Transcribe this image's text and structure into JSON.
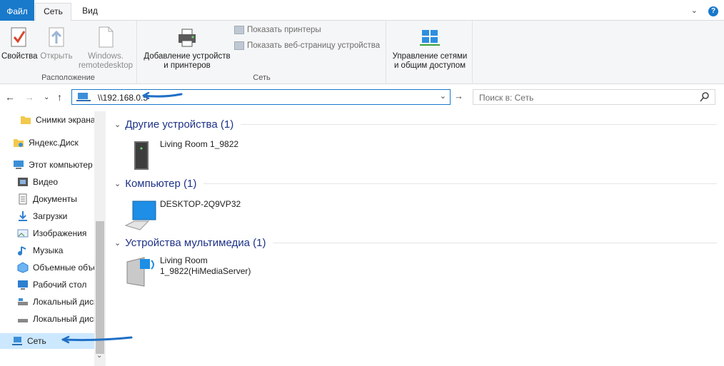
{
  "ribbon": {
    "tabs": {
      "file": "Файл",
      "network": "Сеть",
      "view": "Вид"
    },
    "groups": {
      "location": {
        "label": "Расположение",
        "properties": "Свойства",
        "open": "Открыть",
        "windows_remote_1": "Windows.",
        "windows_remote_2": "remotedesktop"
      },
      "network": {
        "label": "Сеть",
        "add_devices_1": "Добавление устройств",
        "add_devices_2": "и принтеров",
        "show_printers": "Показать принтеры",
        "show_device_page": "Показать веб-страницу устройства"
      },
      "manage": {
        "manage_1": "Управление сетями",
        "manage_2": "и общим доступом"
      }
    }
  },
  "address": {
    "path": "\\\\192.168.0.5",
    "search_placeholder": "Поиск в: Сеть"
  },
  "sidebar": {
    "items": [
      {
        "label": "Снимки экрана"
      },
      {
        "label": "Яндекс.Диск"
      },
      {
        "label": "Этот компьютер"
      },
      {
        "label": "Видео"
      },
      {
        "label": "Документы"
      },
      {
        "label": "Загрузки"
      },
      {
        "label": "Изображения"
      },
      {
        "label": "Музыка"
      },
      {
        "label": "Объемные объекты"
      },
      {
        "label": "Рабочий стол"
      },
      {
        "label": "Локальный диск (C:)"
      },
      {
        "label": "Локальный диск (D:)"
      },
      {
        "label": "Сеть"
      }
    ]
  },
  "content": {
    "groups": [
      {
        "title": "Другие устройства (1)",
        "device": "Living Room 1_9822"
      },
      {
        "title": "Компьютер (1)",
        "device": "DESKTOP-2Q9VP32"
      },
      {
        "title": "Устройства мультимедиа (1)",
        "device_line1": "Living Room",
        "device_line2": "1_9822(HiMediaServer)"
      }
    ]
  },
  "colors": {
    "accent": "#1979ca",
    "group_title": "#1e3287",
    "selection": "#cce8ff",
    "annotation": "#1f6fc6"
  }
}
